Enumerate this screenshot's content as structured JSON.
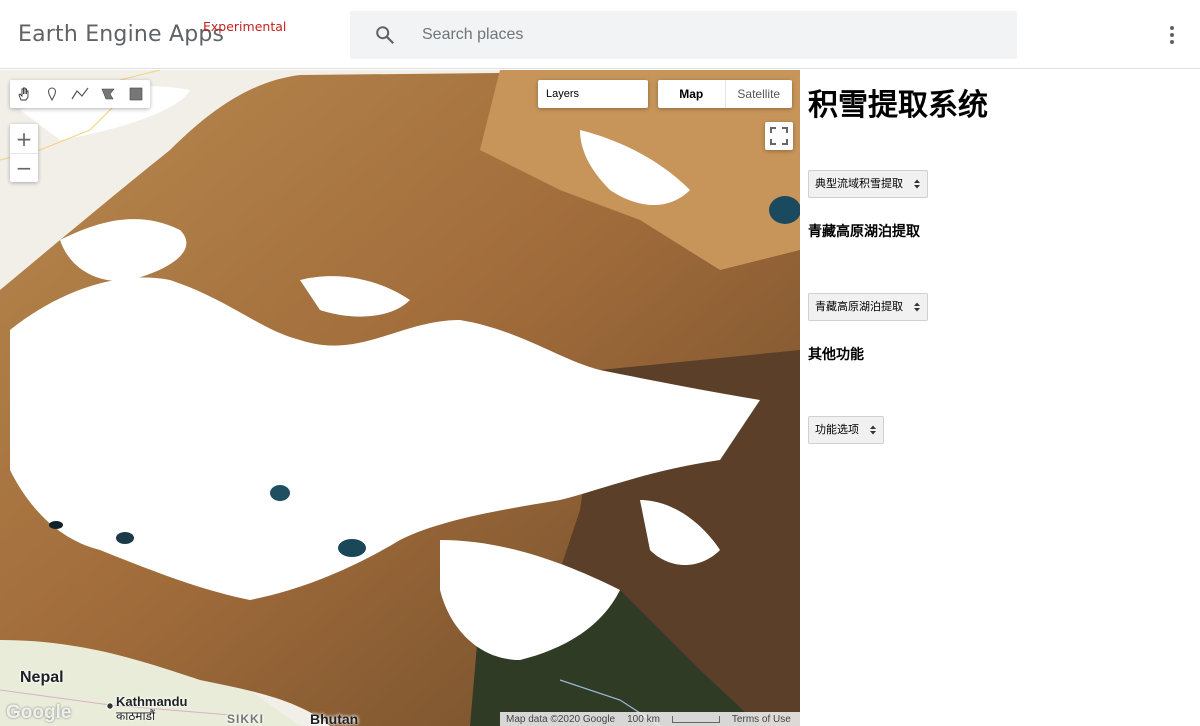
{
  "header": {
    "app_title": "Earth Engine Apps",
    "app_tag": "Experimental",
    "search_placeholder": "Search places",
    "tag_color": "#c5221f"
  },
  "map": {
    "tools": [
      "hand-icon",
      "marker-icon",
      "line-icon",
      "polygon-icon",
      "rectangle-icon"
    ],
    "zoom_in": "+",
    "zoom_out": "−",
    "layers_label": "Layers",
    "map_type_map": "Map",
    "map_type_satellite": "Satellite",
    "places": {
      "nepal": "Nepal",
      "kathmandu": "Kathmandu",
      "kathmandu_local": "काठमाडौं",
      "bhutan": "Bhutan",
      "sikkim": "SIKKI"
    },
    "logo": "Google",
    "attribution": "Map data ©2020 Google",
    "scale": "100 km",
    "terms": "Terms of Use"
  },
  "panel": {
    "title": "积雪提取系统",
    "select1": "典型流域积雪提取",
    "section2": "青藏高原湖泊提取",
    "select2": "青藏高原湖泊提取",
    "section3": "其他功能",
    "select3": "功能选项"
  }
}
